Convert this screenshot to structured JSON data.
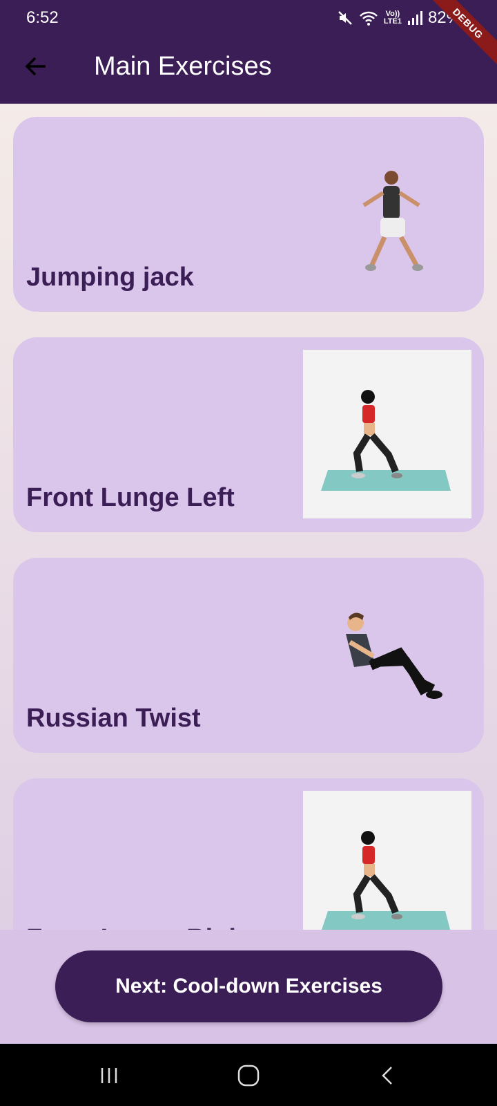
{
  "status_bar": {
    "time": "6:52",
    "battery": "82%",
    "network_label_top": "Vo))",
    "network_label_bottom": "LTE1",
    "debug_label": "DEBUG"
  },
  "app_bar": {
    "title": "Main Exercises",
    "back_icon": "arrow-left-icon"
  },
  "exercises": [
    {
      "label": "Jumping jack",
      "image": "man-jumping-jack-illustration"
    },
    {
      "label": "Front Lunge Left",
      "image": "woman-lunge-illustration"
    },
    {
      "label": "Russian Twist",
      "image": "man-russian-twist-illustration"
    },
    {
      "label": "Front Lunge Right",
      "image": "woman-lunge-illustration"
    }
  ],
  "next_button": {
    "label": "Next: Cool-down Exercises"
  },
  "nav_bar": {
    "recents_icon": "recents-icon",
    "home_icon": "home-icon",
    "back_icon": "back-chevron-icon"
  },
  "colors": {
    "primary": "#3b1e55",
    "card": "#dbc6eb",
    "mat": "#84c8c4",
    "top_accent": "#d62828"
  }
}
